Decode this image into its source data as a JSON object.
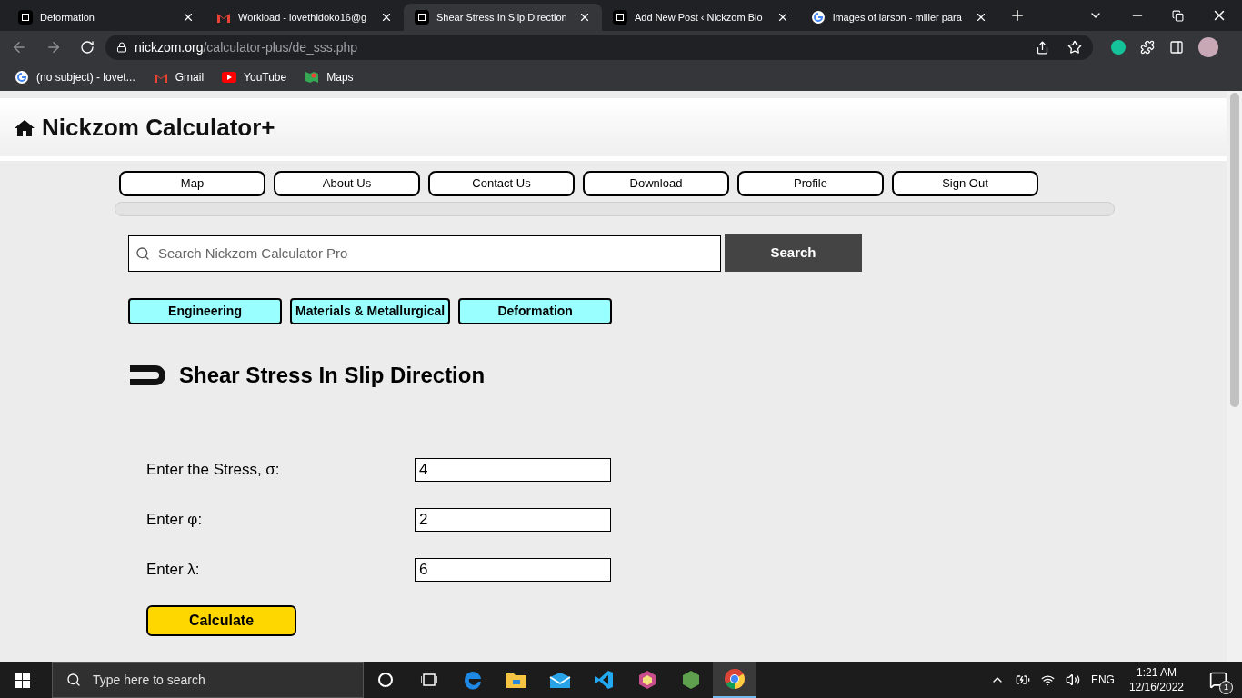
{
  "browser": {
    "tabs": [
      {
        "title": "Deformation",
        "kind": "nickzom",
        "selected": false
      },
      {
        "title": "Workload - lovethidoko16@g",
        "kind": "gmail",
        "selected": false
      },
      {
        "title": "Shear Stress In Slip Direction",
        "kind": "nickzom",
        "selected": true
      },
      {
        "title": "Add New Post ‹ Nickzom Blo",
        "kind": "nickzom",
        "selected": false
      },
      {
        "title": "images of larson - miller para",
        "kind": "google",
        "selected": false
      }
    ],
    "url": {
      "domain": "nickzom.org",
      "path": "/calculator-plus/de_sss.php"
    },
    "bookmarks": [
      {
        "title": "(no subject) - lovet...",
        "kind": "google"
      },
      {
        "title": "Gmail",
        "kind": "gmail"
      },
      {
        "title": "YouTube",
        "kind": "youtube"
      },
      {
        "title": "Maps",
        "kind": "maps"
      }
    ]
  },
  "page": {
    "site_title": "Nickzom Calculator+",
    "nav": [
      "Map",
      "About Us",
      "Contact Us",
      "Download",
      "Profile",
      "Sign Out"
    ],
    "search": {
      "placeholder": "Search Nickzom Calculator Pro",
      "button": "Search"
    },
    "breadcrumbs": [
      "Engineering",
      "Materials & Metallurgical",
      "Deformation"
    ],
    "heading": "Shear Stress In Slip Direction",
    "fields": [
      {
        "label": "Enter the Stress, σ:",
        "value": "4"
      },
      {
        "label": "Enter φ:",
        "value": "2"
      },
      {
        "label": "Enter λ:",
        "value": "6"
      }
    ],
    "calculate_button": "Calculate"
  },
  "taskbar": {
    "search_placeholder": "Type here to search",
    "apps": [
      {
        "kind": "cortana",
        "selected": false
      },
      {
        "kind": "taskview",
        "selected": false
      },
      {
        "kind": "edge",
        "selected": false
      },
      {
        "kind": "explorer",
        "selected": false
      },
      {
        "kind": "mail",
        "selected": false
      },
      {
        "kind": "vscode",
        "selected": false
      },
      {
        "kind": "box",
        "selected": false
      },
      {
        "kind": "node",
        "selected": false
      },
      {
        "kind": "chrome",
        "selected": true
      }
    ],
    "language": "ENG",
    "time": "1:21 AM",
    "date": "12/16/2022",
    "notifications": "1"
  }
}
